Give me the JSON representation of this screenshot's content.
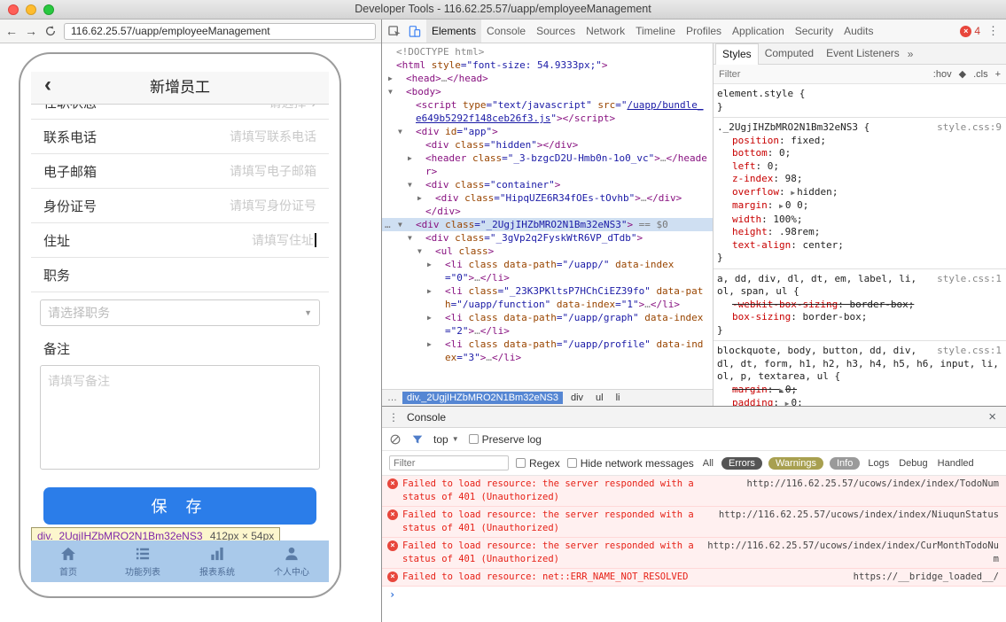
{
  "titlebar": {
    "title": "Developer Tools - 116.62.25.57/uapp/employeeManagement"
  },
  "browser": {
    "url": "116.62.25.57/uapp/employeeManagement"
  },
  "colors": {
    "save_button": "#2b7de9",
    "inspect_highlight": "#a9c9ea",
    "error_red": "#e8463c",
    "devtools_accent": "#4285f4",
    "selected_node_bg": "#cfdff2"
  },
  "app": {
    "back_icon": "‹",
    "title": "新增员工",
    "clipped_row": {
      "label": "任职状态",
      "value": "请选择",
      "chevron": "›"
    },
    "fields": [
      {
        "label": "联系电话",
        "placeholder": "请填写联系电话"
      },
      {
        "label": "电子邮箱",
        "placeholder": "请填写电子邮箱"
      },
      {
        "label": "身份证号",
        "placeholder": "请填写身份证号"
      },
      {
        "label": "住址",
        "placeholder": "请填写住址",
        "focused": true
      }
    ],
    "job": {
      "label": "职务",
      "select_placeholder": "请选择职务"
    },
    "note": {
      "label": "备注",
      "placeholder": "请填写备注"
    },
    "save_button": "保 存",
    "size_tooltip": {
      "selector": "div._2UgjIHZbMRO2N1Bm32eNS3",
      "size": "412px × 54px"
    },
    "tabbar": [
      {
        "icon": "home",
        "label": "首页"
      },
      {
        "icon": "list",
        "label": "功能列表"
      },
      {
        "icon": "chart",
        "label": "报表系统"
      },
      {
        "icon": "person",
        "label": "个人中心"
      }
    ]
  },
  "devtools": {
    "tabs": [
      {
        "label": "Elements",
        "selected": true
      },
      {
        "label": "Console"
      },
      {
        "label": "Sources"
      },
      {
        "label": "Network"
      },
      {
        "label": "Timeline"
      },
      {
        "label": "Profiles"
      },
      {
        "label": "Application"
      },
      {
        "label": "Security"
      },
      {
        "label": "Audits"
      }
    ],
    "error_count": "4",
    "tree": [
      {
        "i": 0,
        "a": "",
        "segs": [
          [
            "d",
            "<!DOCTYPE html>"
          ]
        ]
      },
      {
        "i": 0,
        "a": "",
        "segs": [
          [
            "t",
            "<html "
          ],
          [
            "a",
            "style"
          ],
          [
            "v",
            "=\"font-size: 54.9333px;\""
          ],
          [
            "t",
            ">"
          ]
        ]
      },
      {
        "i": 1,
        "a": "c",
        "segs": [
          [
            "t",
            "<head>"
          ],
          [
            "d",
            "…"
          ],
          [
            "t",
            "</head>"
          ]
        ]
      },
      {
        "i": 1,
        "a": "e",
        "segs": [
          [
            "t",
            "<body>"
          ]
        ]
      },
      {
        "i": 2,
        "a": "",
        "segs": [
          [
            "t",
            "<script "
          ],
          [
            "a",
            "type"
          ],
          [
            "v",
            "=\"text/javascript\""
          ],
          [
            "t",
            " "
          ],
          [
            "a",
            "src"
          ],
          [
            "v",
            "=\""
          ],
          [
            "l",
            "/uapp/bundle_e649b5292f148ceb26f3.js"
          ],
          [
            "v",
            "\""
          ],
          [
            "t",
            "></script>"
          ]
        ]
      },
      {
        "i": 2,
        "a": "e",
        "segs": [
          [
            "t",
            "<div "
          ],
          [
            "a",
            "id"
          ],
          [
            "v",
            "=\"app\""
          ],
          [
            "t",
            ">"
          ]
        ]
      },
      {
        "i": 3,
        "a": "",
        "segs": [
          [
            "t",
            "<div "
          ],
          [
            "a",
            "class"
          ],
          [
            "v",
            "=\"hidden\""
          ],
          [
            "t",
            "></div>"
          ]
        ]
      },
      {
        "i": 3,
        "a": "c",
        "segs": [
          [
            "t",
            "<header "
          ],
          [
            "a",
            "class"
          ],
          [
            "v",
            "=\"_3-bzgcD2U-Hmb0n-1o0_vc\""
          ],
          [
            "t",
            ">"
          ],
          [
            "d",
            "…"
          ],
          [
            "t",
            "</header>"
          ]
        ]
      },
      {
        "i": 3,
        "a": "e",
        "segs": [
          [
            "t",
            "<div "
          ],
          [
            "a",
            "class"
          ],
          [
            "v",
            "=\"container\""
          ],
          [
            "t",
            ">"
          ]
        ]
      },
      {
        "i": 4,
        "a": "c",
        "segs": [
          [
            "t",
            "<div "
          ],
          [
            "a",
            "class"
          ],
          [
            "v",
            "=\"HipqUZE6R34fOEs-tOvhb\""
          ],
          [
            "t",
            ">"
          ],
          [
            "d",
            "…"
          ],
          [
            "t",
            "</div>"
          ]
        ]
      },
      {
        "i": 3,
        "a": "",
        "segs": [
          [
            "t",
            "</div>"
          ]
        ]
      },
      {
        "i": 2,
        "a": "e",
        "sel": true,
        "g": "…",
        "segs": [
          [
            "t",
            "<div "
          ],
          [
            "a",
            "class"
          ],
          [
            "v",
            "=\"_2UgjIHZbMRO2N1Bm32eNS3\""
          ],
          [
            "t",
            ">"
          ],
          [
            "m",
            " == $0"
          ]
        ]
      },
      {
        "i": 3,
        "a": "e",
        "segs": [
          [
            "t",
            "<div "
          ],
          [
            "a",
            "class"
          ],
          [
            "v",
            "=\"_3gVp2q2FyskWtR6VP_dTdb\""
          ],
          [
            "t",
            ">"
          ]
        ]
      },
      {
        "i": 4,
        "a": "e",
        "segs": [
          [
            "t",
            "<ul "
          ],
          [
            "a",
            "class"
          ],
          [
            "t",
            ">"
          ]
        ]
      },
      {
        "i": 5,
        "a": "c",
        "segs": [
          [
            "t",
            "<li "
          ],
          [
            "a",
            "class"
          ],
          [
            "t",
            " "
          ],
          [
            "a",
            "data-path"
          ],
          [
            "v",
            "=\"/uapp/\""
          ],
          [
            "t",
            " "
          ],
          [
            "a",
            "data-index"
          ],
          [
            "v",
            "=\"0\""
          ],
          [
            "t",
            ">"
          ],
          [
            "d",
            "…"
          ],
          [
            "t",
            "</li>"
          ]
        ]
      },
      {
        "i": 5,
        "a": "c",
        "segs": [
          [
            "t",
            "<li "
          ],
          [
            "a",
            "class"
          ],
          [
            "v",
            "=\"_23K3PKltsP7HChCiEZ39fo\""
          ],
          [
            "t",
            " "
          ],
          [
            "a",
            "data-path"
          ],
          [
            "v",
            "=\"/uapp/function\""
          ],
          [
            "t",
            " "
          ],
          [
            "a",
            "data-index"
          ],
          [
            "v",
            "=\"1\""
          ],
          [
            "t",
            ">"
          ],
          [
            "d",
            "…"
          ],
          [
            "t",
            "</li>"
          ]
        ]
      },
      {
        "i": 5,
        "a": "c",
        "segs": [
          [
            "t",
            "<li "
          ],
          [
            "a",
            "class"
          ],
          [
            "t",
            " "
          ],
          [
            "a",
            "data-path"
          ],
          [
            "v",
            "=\"/uapp/graph\""
          ],
          [
            "t",
            " "
          ],
          [
            "a",
            "data-index"
          ],
          [
            "v",
            "=\"2\""
          ],
          [
            "t",
            ">"
          ],
          [
            "d",
            "…"
          ],
          [
            "t",
            "</li>"
          ]
        ]
      },
      {
        "i": 5,
        "a": "c",
        "segs": [
          [
            "t",
            "<li "
          ],
          [
            "a",
            "class"
          ],
          [
            "t",
            " "
          ],
          [
            "a",
            "data-path"
          ],
          [
            "v",
            "=\"/uapp/profile\""
          ],
          [
            "t",
            " "
          ],
          [
            "a",
            "data-index"
          ],
          [
            "v",
            "=\"3\""
          ],
          [
            "t",
            ">"
          ],
          [
            "d",
            "…"
          ],
          [
            "t",
            "</li>"
          ]
        ]
      }
    ],
    "breadcrumb": {
      "overflow": "…",
      "crumbs": [
        {
          "label": "div._2UgjIHZbMRO2N1Bm32eNS3",
          "selected": true
        },
        {
          "label": "div"
        },
        {
          "label": "ul"
        },
        {
          "label": "li"
        }
      ]
    },
    "styles_pane": {
      "tabs": [
        {
          "label": "Styles",
          "selected": true
        },
        {
          "label": "Computed"
        },
        {
          "label": "Event Listeners"
        }
      ],
      "more_icon": "»",
      "filter_placeholder": "Filter",
      "controls": {
        "hov": ":hov",
        "diamond": "◆",
        "cls": ".cls",
        "plus": "+"
      },
      "rules": [
        {
          "selector": "element.style",
          "link": "",
          "props": []
        },
        {
          "selector": "._2UgjIHZbMRO2N1Bm32eNS3",
          "link": "style.css:9",
          "props": [
            {
              "name": "position",
              "value": "fixed"
            },
            {
              "name": "bottom",
              "value": "0"
            },
            {
              "name": "left",
              "value": "0"
            },
            {
              "name": "z-index",
              "value": "98"
            },
            {
              "name": "overflow",
              "value": "hidden",
              "arrow": true
            },
            {
              "name": "margin",
              "value": "0 0",
              "arrow": true
            },
            {
              "name": "width",
              "value": "100%"
            },
            {
              "name": "height",
              "value": ".98rem"
            },
            {
              "name": "text-align",
              "value": "center"
            }
          ]
        },
        {
          "selector": "a, dd, div, dl, dt, em, label, li, ol, span, ul",
          "link": "style.css:1",
          "props": [
            {
              "name": "-webkit-box-sizing",
              "value": "border-box",
              "struck": true
            },
            {
              "name": "box-sizing",
              "value": "border-box"
            }
          ]
        },
        {
          "selector": "blockquote, body, button, dd, div, dl, dt, form, h1, h2, h3, h4, h5, h6, input, li, ol, p, textarea, ul",
          "link": "style.css:1",
          "props": [
            {
              "name": "margin",
              "value": "0",
              "struck": true,
              "arrow": true
            },
            {
              "name": "padding",
              "value": "0",
              "arrow": true
            }
          ]
        }
      ]
    },
    "console": {
      "title": "Console",
      "kebab": "⋮",
      "close": "×",
      "context": "top",
      "preserve_log": "Preserve log",
      "filter_placeholder": "Filter",
      "regex_label": "Regex",
      "hide_network_label": "Hide network messages",
      "prompt": "›",
      "levels": [
        {
          "label": "All",
          "style": "plain"
        },
        {
          "label": "Errors",
          "style": "errors"
        },
        {
          "label": "Warnings",
          "style": "warnings"
        },
        {
          "label": "Info",
          "style": "info"
        },
        {
          "label": "Logs",
          "style": "plain"
        },
        {
          "label": "Debug",
          "style": "plain"
        },
        {
          "label": "Handled",
          "style": "plain"
        }
      ],
      "messages": [
        {
          "text": "Failed to load resource: the server responded with a status of 401 (Unauthorized)",
          "source": "http://116.62.25.57/ucows/index/index/TodoNum"
        },
        {
          "text": "Failed to load resource: the server responded with a status of 401 (Unauthorized)",
          "source": "http://116.62.25.57/ucows/index/index/NiuqunStatus"
        },
        {
          "text": "Failed to load resource: the server responded with a status of 401 (Unauthorized)",
          "source": "http://116.62.25.57/ucows/index/index/CurMonthTodoNum"
        },
        {
          "text": "Failed to load resource: net::ERR_NAME_NOT_RESOLVED",
          "source": "https://__bridge_loaded__/"
        }
      ]
    }
  }
}
